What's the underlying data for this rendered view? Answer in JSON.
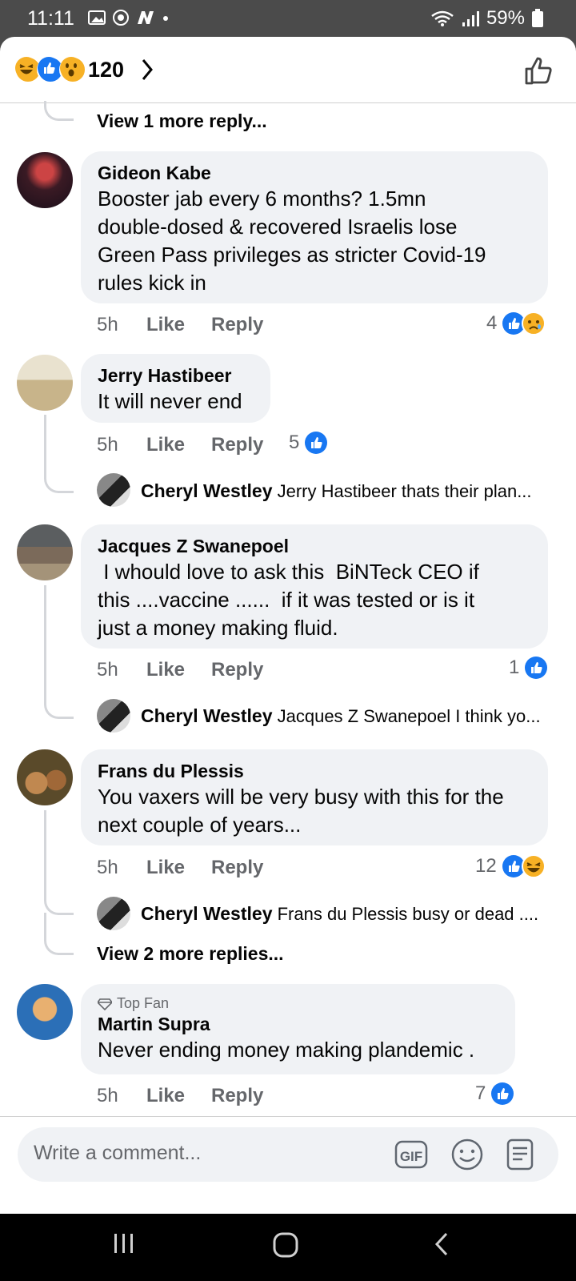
{
  "status": {
    "time": "11:11",
    "battery": "59%"
  },
  "header": {
    "reaction_count": "120"
  },
  "thread_top": {
    "more": "View 1 more reply..."
  },
  "comments": [
    {
      "name": "Gideon Kabe",
      "text": "Booster jab every 6 months? 1.5mn\ndouble-dosed & recovered Israelis lose\nGreen Pass privileges as stricter Covid-19\nrules kick in",
      "time": "5h",
      "like": "Like",
      "reply": "Reply",
      "reactions": "4"
    },
    {
      "name": "Jerry Hastibeer",
      "text": "It will never end",
      "time": "5h",
      "like": "Like",
      "reply": "Reply",
      "reactions": "5",
      "sub": {
        "name": "Cheryl Westley",
        "text": "Jerry Hastibeer thats their plan..."
      }
    },
    {
      "name": "Jacques Z Swanepoel",
      "text": " I whould love to ask this  BiNTeck CEO if\nthis ....vaccine ......  if it was tested or is it\njust a money making fluid.",
      "time": "5h",
      "like": "Like",
      "reply": "Reply",
      "reactions": "1",
      "sub": {
        "name": "Cheryl Westley",
        "text": "Jacques Z Swanepoel I think yo..."
      }
    },
    {
      "name": "Frans du Plessis",
      "text": "You vaxers will be very busy with this for the\nnext couple of years...",
      "time": "5h",
      "like": "Like",
      "reply": "Reply",
      "reactions": "12",
      "sub": {
        "name": "Cheryl Westley",
        "text": "Frans du Plessis busy or dead ...."
      },
      "more": "View 2 more replies..."
    },
    {
      "badge": "Top Fan",
      "name": "Martin Supra",
      "text": "Never ending money making plandemic .",
      "time": "5h",
      "like": "Like",
      "reply": "Reply",
      "reactions": "7"
    }
  ],
  "composer": {
    "placeholder": "Write a comment...",
    "gif": "GIF"
  }
}
